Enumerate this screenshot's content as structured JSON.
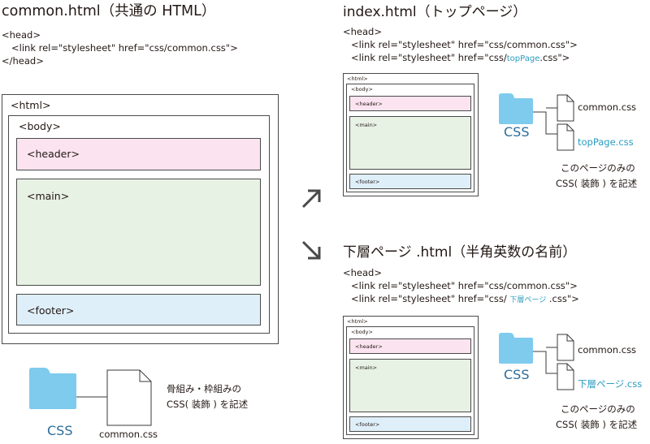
{
  "common": {
    "title": "common.html（共通の HTML）",
    "head_lines": [
      "<head>",
      "<link rel=\"stylesheet\" href=\"css/common.css\">",
      "</head>"
    ],
    "tags": {
      "html": "<html>",
      "body": "<body>",
      "header": "<header>",
      "main": "<main>",
      "footer": "<footer>"
    },
    "css_folder_label": "CSS",
    "file_label": "common.css",
    "note_lines": [
      "骨組み・枠組みの",
      "CSS( 装飾 ) を記述"
    ]
  },
  "index": {
    "title": "index.html（トップページ）",
    "head_line": "<head>",
    "link1": "<link rel=\"stylesheet\" href=\"css/common.css\">",
    "link2_prefix": "<link rel=\"stylesheet\" href=\"css/",
    "link2_accent": "topPage",
    "link2_suffix": ".css\">",
    "tags": {
      "html": "<html>",
      "body": "<body>",
      "header": "<header>",
      "main": "<main>",
      "footer": "<footer>"
    },
    "css_folder_label": "CSS",
    "file1": "common.css",
    "file2": "topPage.css",
    "note_lines": [
      "このページのみの",
      "CSS( 装飾 ) を記述"
    ]
  },
  "sub": {
    "title": "下層ページ .html（半角英数の名前）",
    "head_line": "<head>",
    "link1": "<link rel=\"stylesheet\" href=\"css/common.css\">",
    "link2_prefix": "<link rel=\"stylesheet\" href=\"css/ ",
    "link2_accent": "下層ページ",
    "link2_suffix": " .css\">",
    "tags": {
      "html": "<html>",
      "body": "<body>",
      "header": "<header>",
      "main": "<main>",
      "footer": "<footer>"
    },
    "css_folder_label": "CSS",
    "file1": "common.css",
    "file2": "下層ページ.css",
    "note_lines": [
      "このページのみの",
      "CSS( 装飾 ) を記述"
    ]
  },
  "colors": {
    "header": "#fbe4ef",
    "main": "#e7f1e4",
    "footer": "#dfeff9",
    "folder": "#7ecbee",
    "accent": "#2a9cc0",
    "css_label": "#2c6c9a"
  },
  "icons": [
    "folder-icon",
    "document-icon",
    "arrow-up-right-icon",
    "arrow-down-right-icon"
  ]
}
